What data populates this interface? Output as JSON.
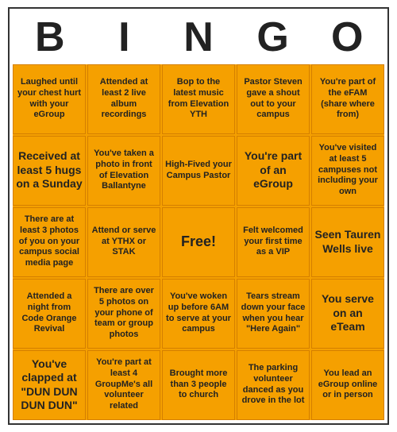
{
  "header": {
    "letters": [
      "B",
      "I",
      "N",
      "G",
      "O"
    ],
    "title": "BINGO"
  },
  "cells": [
    {
      "id": "r1c1",
      "text": "Laughed until your chest hurt with your eGroup"
    },
    {
      "id": "r1c2",
      "text": "Attended at least 2 live album recordings"
    },
    {
      "id": "r1c3",
      "text": "Bop to the latest music from Elevation YTH"
    },
    {
      "id": "r1c4",
      "text": "Pastor Steven gave a shout out to your campus"
    },
    {
      "id": "r1c5",
      "text": "You're part of the eFAM (share where from)"
    },
    {
      "id": "r2c1",
      "text": "Received at least 5 hugs on a Sunday",
      "large": true
    },
    {
      "id": "r2c2",
      "text": "You've taken a photo in front of Elevation Ballantyne"
    },
    {
      "id": "r2c3",
      "text": "High-Fived your Campus Pastor"
    },
    {
      "id": "r2c4",
      "text": "You're part of an eGroup",
      "large": true
    },
    {
      "id": "r2c5",
      "text": "You've visited at least 5 campuses not including your own"
    },
    {
      "id": "r3c1",
      "text": "There are at least 3 photos of you on your campus social media page"
    },
    {
      "id": "r3c2",
      "text": "Attend or serve at YTHX or STAK"
    },
    {
      "id": "r3c3",
      "text": "Free!",
      "free": true
    },
    {
      "id": "r3c4",
      "text": "Felt welcomed your first time as a VIP"
    },
    {
      "id": "r3c5",
      "text": "Seen Tauren Wells live",
      "large": true
    },
    {
      "id": "r4c1",
      "text": "Attended a night from Code Orange Revival"
    },
    {
      "id": "r4c2",
      "text": "There are over 5 photos on your phone of team or group photos"
    },
    {
      "id": "r4c3",
      "text": "You've woken up before 6AM to serve at your campus"
    },
    {
      "id": "r4c4",
      "text": "Tears stream down your face when you hear \"Here Again\""
    },
    {
      "id": "r4c5",
      "text": "You serve on an eTeam",
      "large": true
    },
    {
      "id": "r5c1",
      "text": "You've clapped at \"DUN DUN DUN DUN\"",
      "large": true
    },
    {
      "id": "r5c2",
      "text": "You're part at least 4 GroupMe's all volunteer related"
    },
    {
      "id": "r5c3",
      "text": "Brought more than 3 people to church"
    },
    {
      "id": "r5c4",
      "text": "The parking volunteer danced as you drove in the lot"
    },
    {
      "id": "r5c5",
      "text": "You lead an eGroup online or in person"
    }
  ]
}
